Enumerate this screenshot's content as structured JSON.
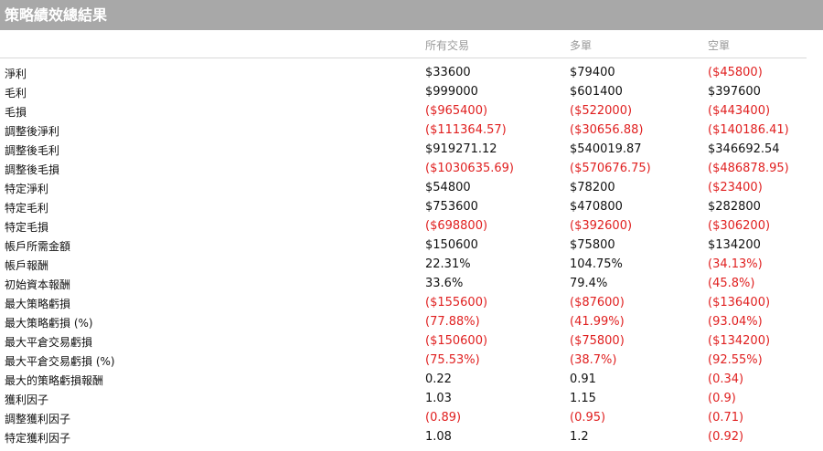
{
  "title": "策略績效總結果",
  "columns": [
    "所有交易",
    "多單",
    "空單"
  ],
  "colors": {
    "negative": "#e02020",
    "header_bg": "#a8a8a8"
  },
  "rows": [
    {
      "label": "淨利",
      "values": [
        "$33600",
        "$79400",
        "($45800)"
      ]
    },
    {
      "label": "毛利",
      "values": [
        "$999000",
        "$601400",
        "$397600"
      ]
    },
    {
      "label": "毛損",
      "values": [
        "($965400)",
        "($522000)",
        "($443400)"
      ]
    },
    {
      "label": "調整後淨利",
      "values": [
        "($111364.57)",
        "($30656.88)",
        "($140186.41)"
      ]
    },
    {
      "label": "調整後毛利",
      "values": [
        "$919271.12",
        "$540019.87",
        "$346692.54"
      ]
    },
    {
      "label": "調整後毛損",
      "values": [
        "($1030635.69)",
        "($570676.75)",
        "($486878.95)"
      ]
    },
    {
      "label": "特定淨利",
      "values": [
        "$54800",
        "$78200",
        "($23400)"
      ]
    },
    {
      "label": "特定毛利",
      "values": [
        "$753600",
        "$470800",
        "$282800"
      ]
    },
    {
      "label": "特定毛損",
      "values": [
        "($698800)",
        "($392600)",
        "($306200)"
      ]
    },
    {
      "label": "帳戶所需金額",
      "values": [
        "$150600",
        "$75800",
        "$134200"
      ]
    },
    {
      "label": "帳戶報酬",
      "values": [
        "22.31%",
        "104.75%",
        "(34.13%)"
      ]
    },
    {
      "label": "初始資本報酬",
      "values": [
        "33.6%",
        "79.4%",
        "(45.8%)"
      ]
    },
    {
      "label": "最大策略虧損",
      "values": [
        "($155600)",
        "($87600)",
        "($136400)"
      ]
    },
    {
      "label": "最大策略虧損 (%)",
      "values": [
        "(77.88%)",
        "(41.99%)",
        "(93.04%)"
      ]
    },
    {
      "label": "最大平倉交易虧損",
      "values": [
        "($150600)",
        "($75800)",
        "($134200)"
      ]
    },
    {
      "label": "最大平倉交易虧損 (%)",
      "values": [
        "(75.53%)",
        "(38.7%)",
        "(92.55%)"
      ]
    },
    {
      "label": "最大的策略虧損報酬",
      "values": [
        "0.22",
        "0.91",
        "(0.34)"
      ]
    },
    {
      "label": "獲利因子",
      "values": [
        "1.03",
        "1.15",
        "(0.9)"
      ]
    },
    {
      "label": "調整獲利因子",
      "values": [
        "(0.89)",
        "(0.95)",
        "(0.71)"
      ]
    },
    {
      "label": "特定獲利因子",
      "values": [
        "1.08",
        "1.2",
        "(0.92)"
      ]
    }
  ]
}
